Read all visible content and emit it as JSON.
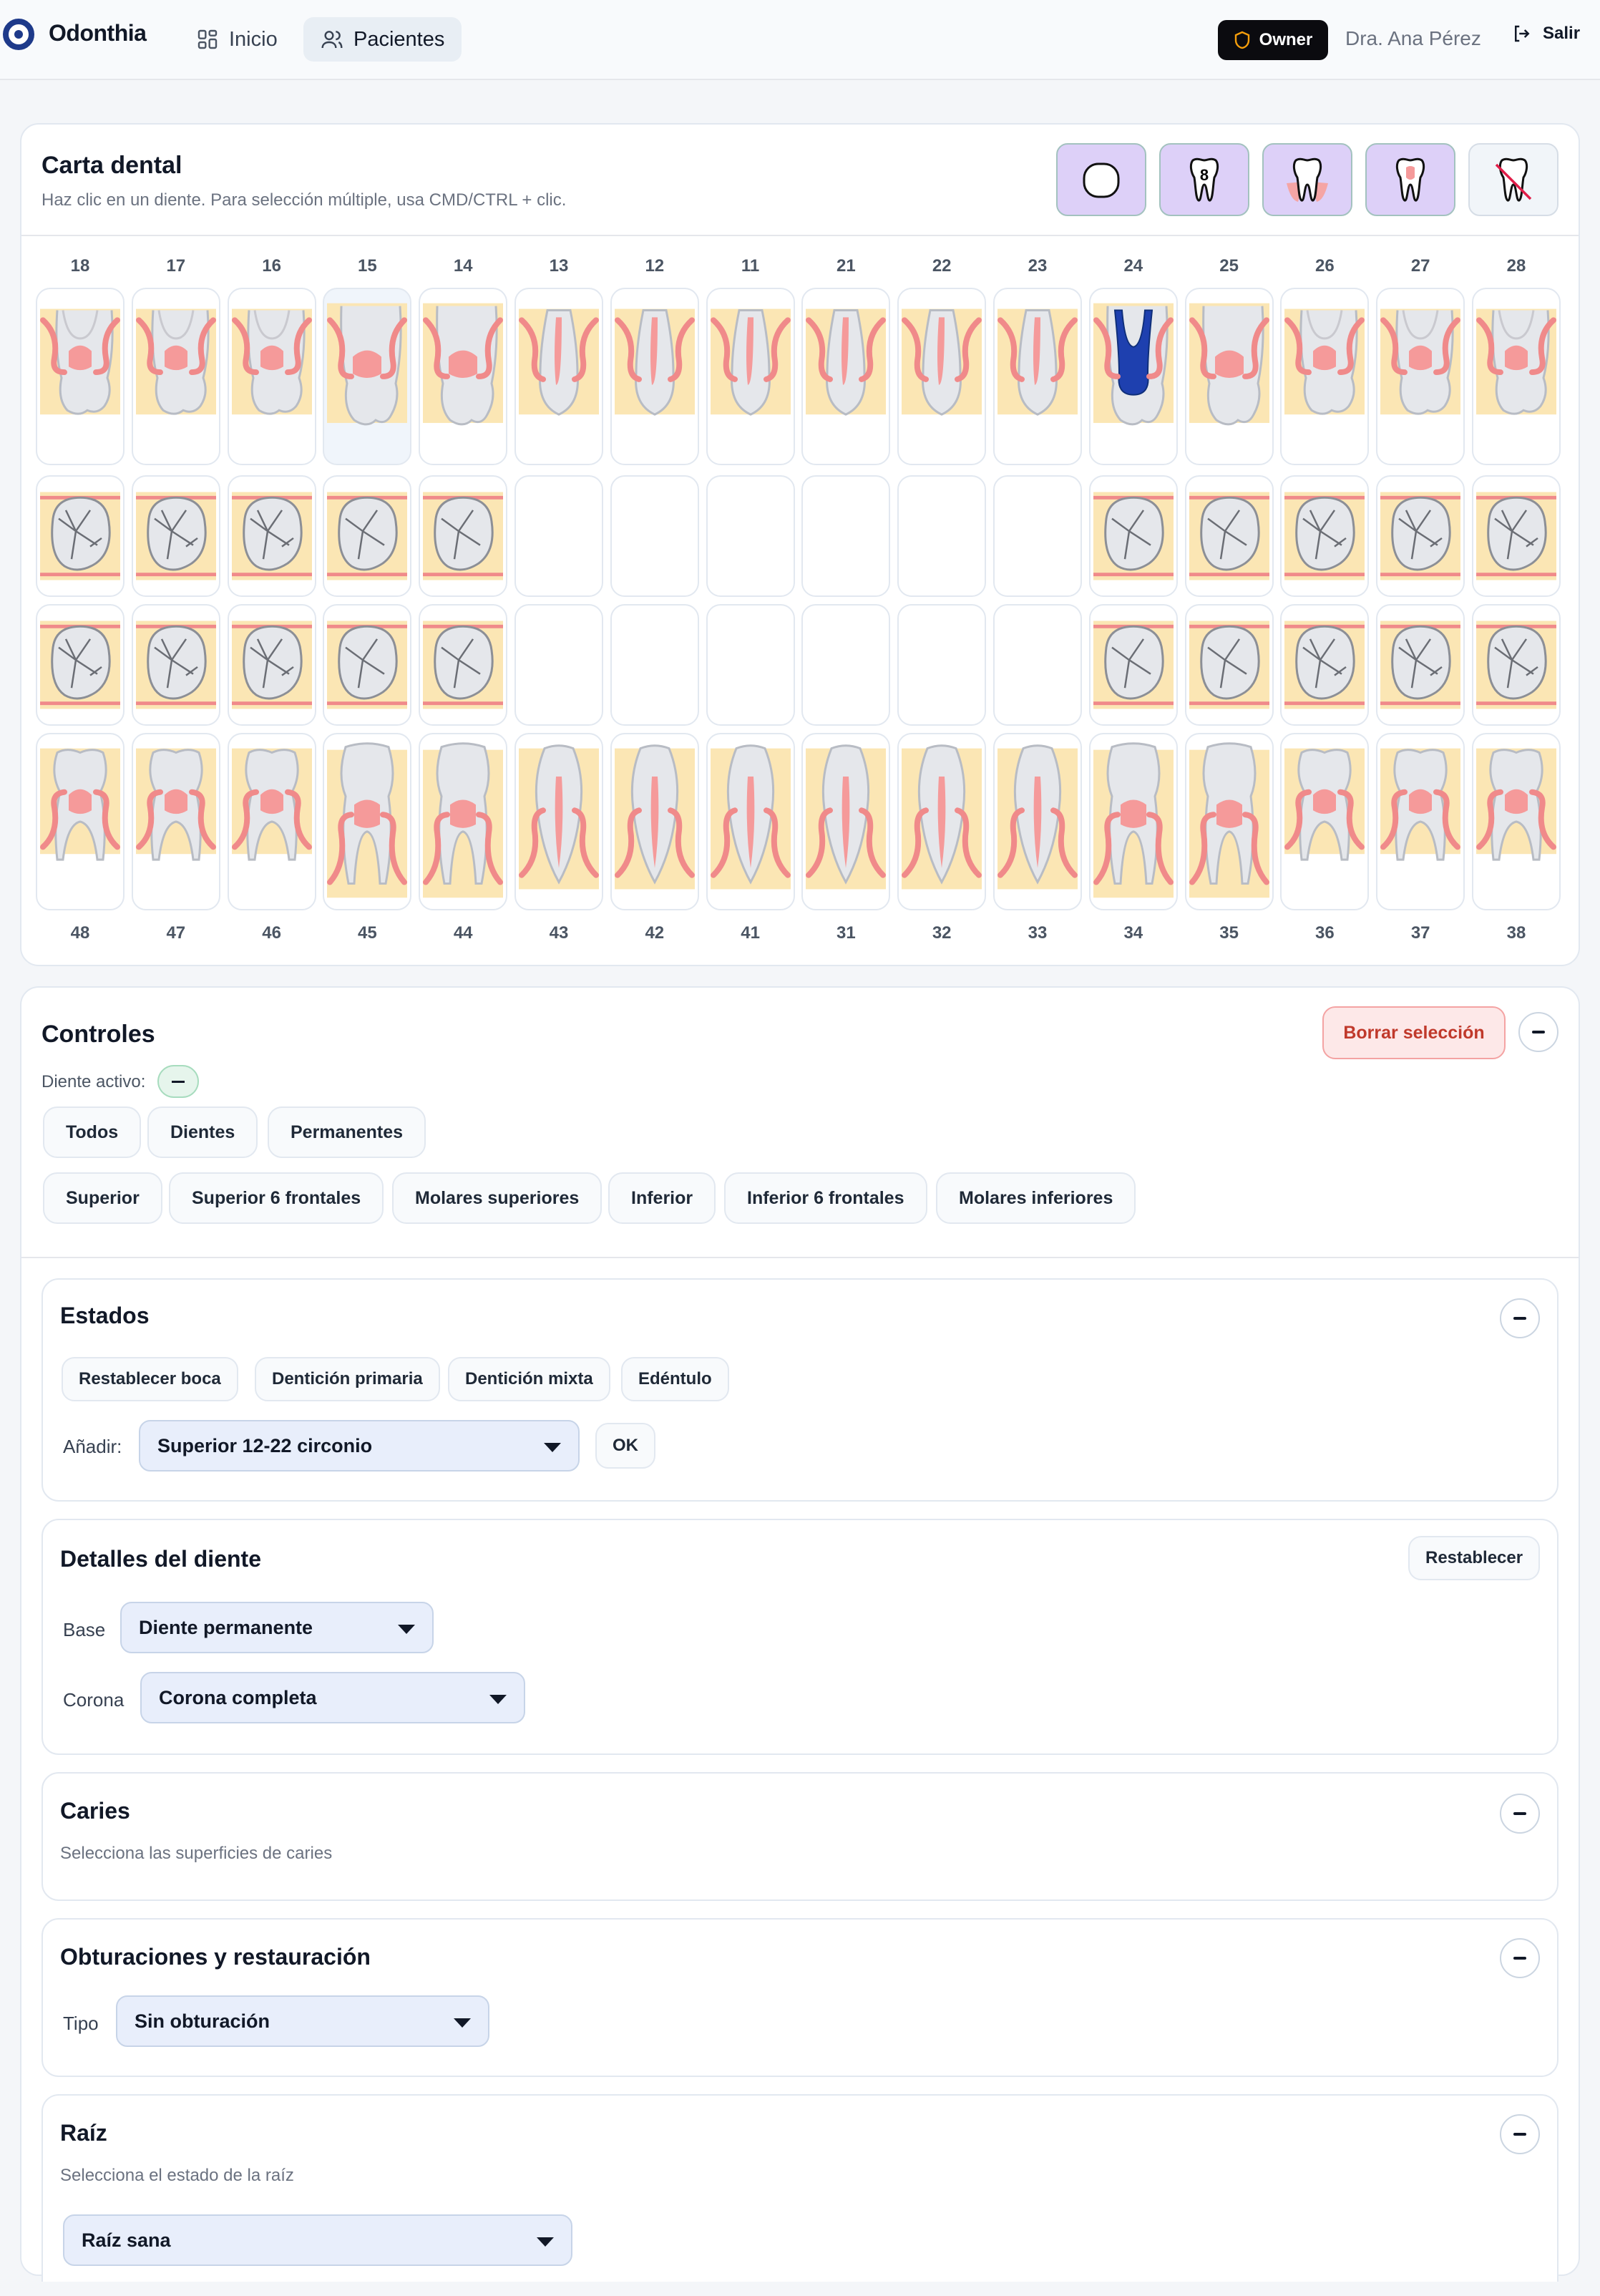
{
  "header": {
    "brand": "Odonthia",
    "nav": [
      {
        "label": "Inicio",
        "icon": "grid-icon",
        "active": false
      },
      {
        "label": "Pacientes",
        "icon": "users-icon",
        "active": true
      }
    ],
    "role_badge": "Owner",
    "user_name": "Dra. Ana Pérez",
    "logout_label": "Salir"
  },
  "chart": {
    "title": "Carta dental",
    "subtitle": "Haz clic en un diente. Para selección múltiple, usa CMD/CTRL + clic.",
    "tools": [
      {
        "icon": "outline-tooth-icon",
        "active": true
      },
      {
        "icon": "tooth-number-icon",
        "active": true
      },
      {
        "icon": "gum-tooth-icon",
        "active": true
      },
      {
        "icon": "pulp-tooth-icon",
        "active": true
      },
      {
        "icon": "missing-tooth-icon",
        "active": false
      }
    ],
    "upper_numbers": [
      "18",
      "17",
      "16",
      "15",
      "14",
      "13",
      "12",
      "11",
      "21",
      "22",
      "23",
      "24",
      "25",
      "26",
      "27",
      "28"
    ],
    "lower_numbers": [
      "48",
      "47",
      "46",
      "45",
      "44",
      "43",
      "42",
      "41",
      "31",
      "32",
      "33",
      "34",
      "35",
      "36",
      "37",
      "38"
    ],
    "highlighted_tooth": "15",
    "root_canal_tooth": "24",
    "colors": {
      "root_canal": "#1e40af",
      "gum": "#f08a8a",
      "bone": "#fbe6b4",
      "tooth": "#e5e7eb"
    }
  },
  "controls": {
    "title": "Controles",
    "clear_label": "Borrar selección",
    "active_label": "Diente activo:",
    "groups_row1": [
      "Todos",
      "Dientes",
      "Permanentes"
    ],
    "groups_row2": [
      "Superior",
      "Superior 6 frontales",
      "Molares superiores",
      "Inferior",
      "Inferior 6 frontales",
      "Molares inferiores"
    ]
  },
  "states": {
    "title": "Estados",
    "buttons": [
      "Restablecer boca",
      "Dentición primaria",
      "Dentición mixta",
      "Edéntulo"
    ],
    "add_label": "Añadir:",
    "add_value": "Superior 12-22 circonio",
    "ok_label": "OK"
  },
  "details": {
    "title": "Detalles del diente",
    "reset_label": "Restablecer",
    "base_label": "Base",
    "base_value": "Diente permanente",
    "crown_label": "Corona",
    "crown_value": "Corona completa"
  },
  "caries": {
    "title": "Caries",
    "hint": "Selecciona las superficies de caries"
  },
  "fillings": {
    "title": "Obturaciones y restauración",
    "type_label": "Tipo",
    "type_value": "Sin obturación"
  },
  "root": {
    "title": "Raíz",
    "hint": "Selecciona el estado de la raíz",
    "value": "Raíz sana"
  }
}
